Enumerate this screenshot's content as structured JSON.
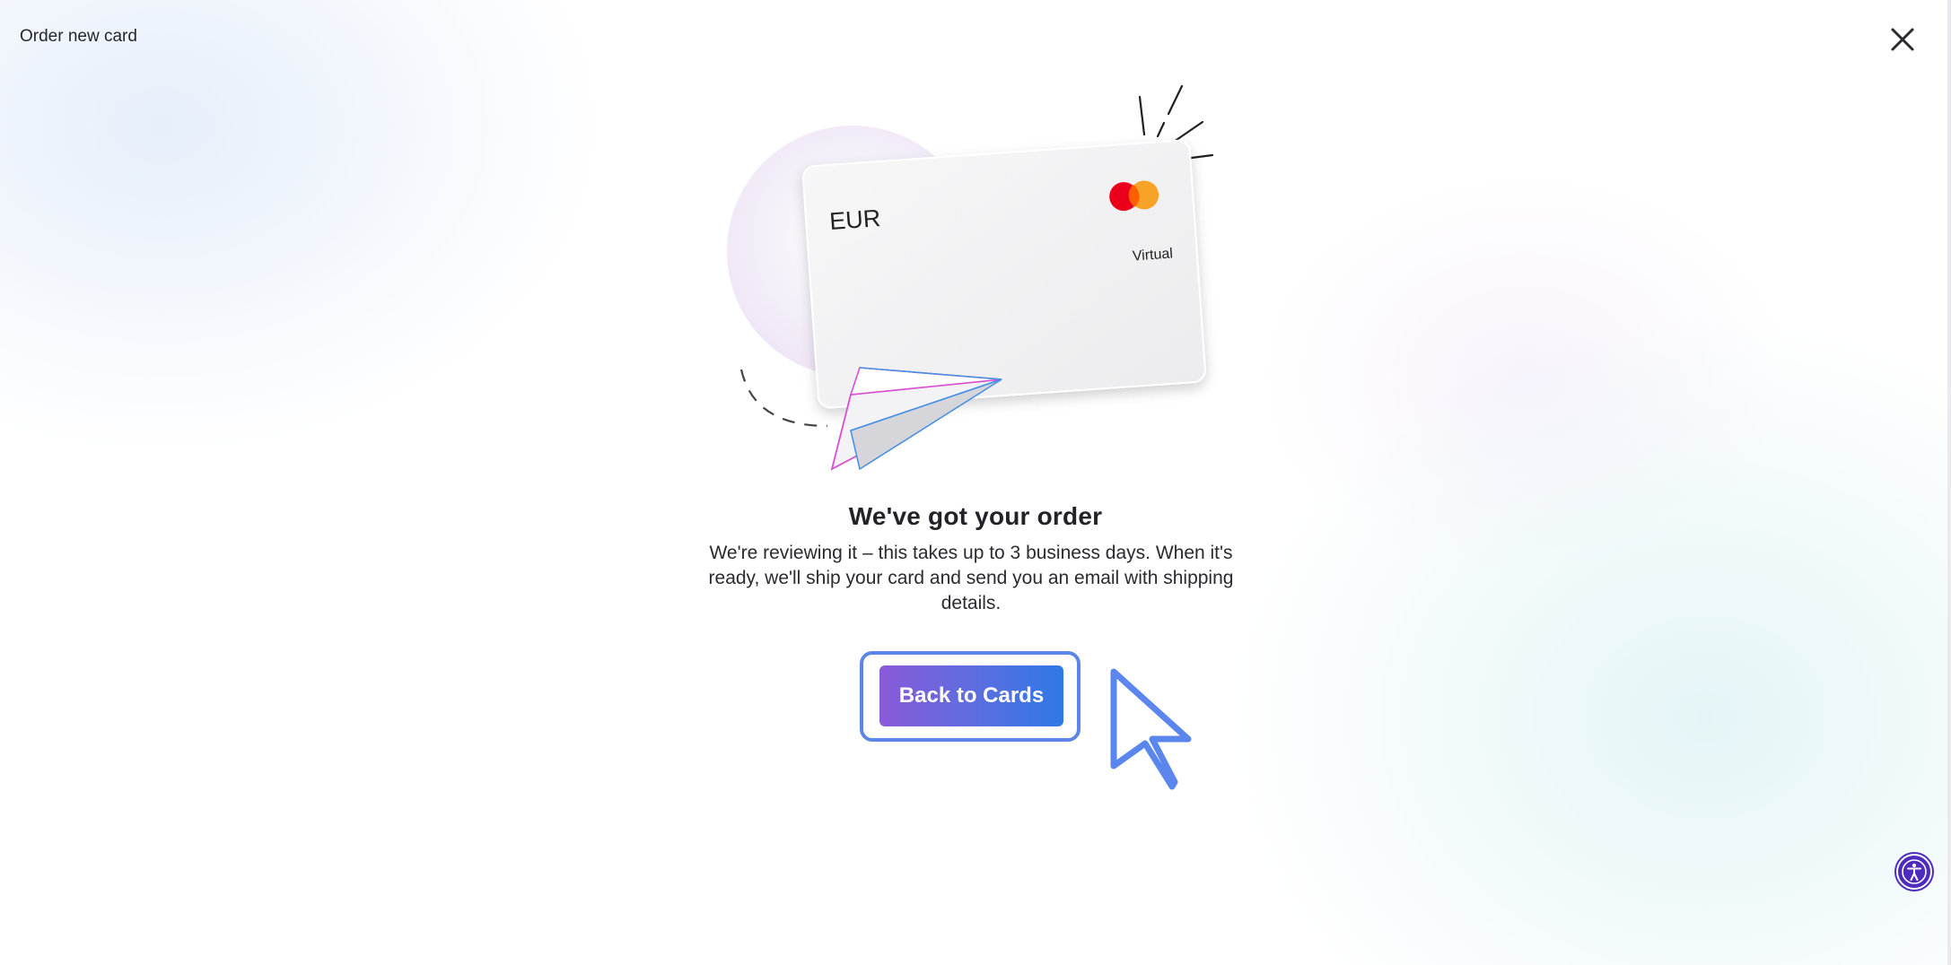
{
  "header": {
    "title": "Order new card"
  },
  "icons": {
    "close": "close-icon",
    "accessibility": "accessibility-icon",
    "cursor": "pointer-cursor-icon"
  },
  "card": {
    "currency": "EUR",
    "type": "Virtual",
    "network_logo": "mastercard-logo"
  },
  "confirmation": {
    "headline": "We've got your order",
    "message": "We're reviewing it – this takes up to 3 business days. When it's ready, we'll ship your card and send you an email with shipping details."
  },
  "actions": {
    "back_label": "Back to Cards"
  },
  "colors": {
    "button_gradient_start": "#8a5ad8",
    "button_gradient_end": "#2f78e6",
    "focus_ring": "#5b86e8",
    "accessibility_button": "#4c2bbd",
    "plane_pink": "#d94fd2",
    "plane_blue": "#4a90e2",
    "mastercard_red": "#eb001b",
    "mastercard_orange": "#f79e1b"
  }
}
